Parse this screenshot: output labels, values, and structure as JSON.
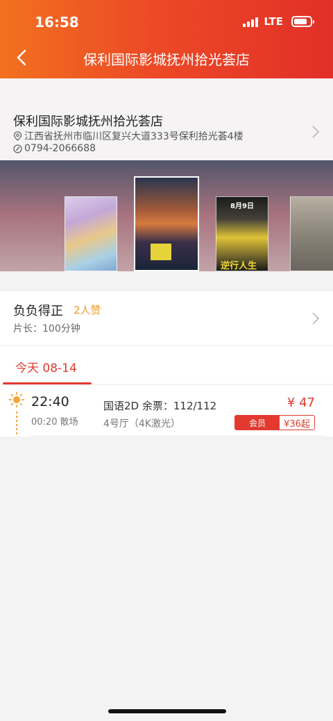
{
  "status": {
    "time": "16:58",
    "network": "LTE"
  },
  "nav": {
    "title": "保利国际影城抚州拾光荟店"
  },
  "cinema": {
    "name": "保利国际影城抚州拾光荟店",
    "address": "江西省抚州市临川区复兴大道333号保利拾光荟4楼",
    "phone": "0794-2066688"
  },
  "posters": [
    {
      "name": "poster-1"
    },
    {
      "name": "poster-2-selected",
      "title_art": "负负得正"
    },
    {
      "name": "poster-3",
      "date": "8月9日",
      "tag": "逆行人生"
    },
    {
      "name": "poster-4"
    }
  ],
  "movie": {
    "title": "负负得正",
    "likes": "2人赞",
    "duration": "片长：100分钟"
  },
  "date_tabs": [
    {
      "label": "今天 08-14",
      "active": true
    }
  ],
  "showtimes": [
    {
      "start": "22:40",
      "end": "00:20 散场",
      "language": "国语2D  余票：112/112",
      "hall": "4号厅（4K激光）",
      "price": "¥ 47",
      "member_label": "会员",
      "member_price": "¥36起"
    }
  ],
  "colors": {
    "accent": "#e23a2f",
    "header_start": "#f2711f",
    "header_end": "#e22f28",
    "likes": "#f09b2b"
  }
}
